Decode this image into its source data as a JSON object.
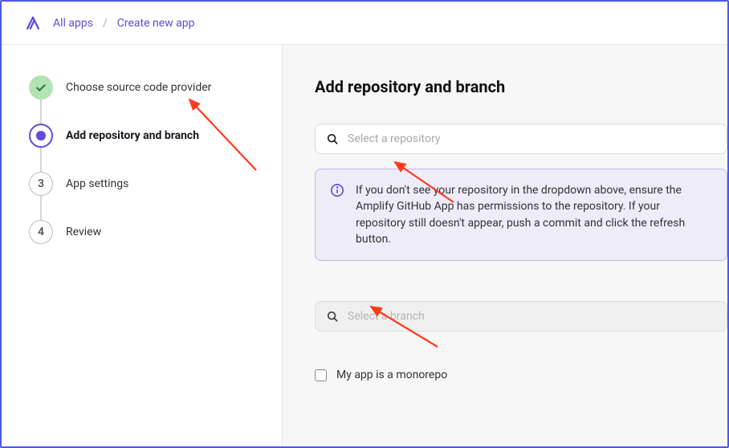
{
  "breadcrumb": {
    "root": "All apps",
    "current": "Create new app"
  },
  "steps": {
    "done": {
      "label": "Choose source code provider"
    },
    "active": {
      "label": "Add repository and branch"
    },
    "pending1": {
      "number": "3",
      "label": "App settings"
    },
    "pending2": {
      "number": "4",
      "label": "Review"
    }
  },
  "main": {
    "heading": "Add repository and branch",
    "repo_placeholder": "Select a repository",
    "info_message": "If you don't see your repository in the dropdown above, ensure the Amplify GitHub App has permissions to the repository. If your repository still doesn't appear, push a commit and click the refresh button.",
    "branch_placeholder": "Select a branch",
    "monorepo_label": "My app is a monorepo"
  }
}
